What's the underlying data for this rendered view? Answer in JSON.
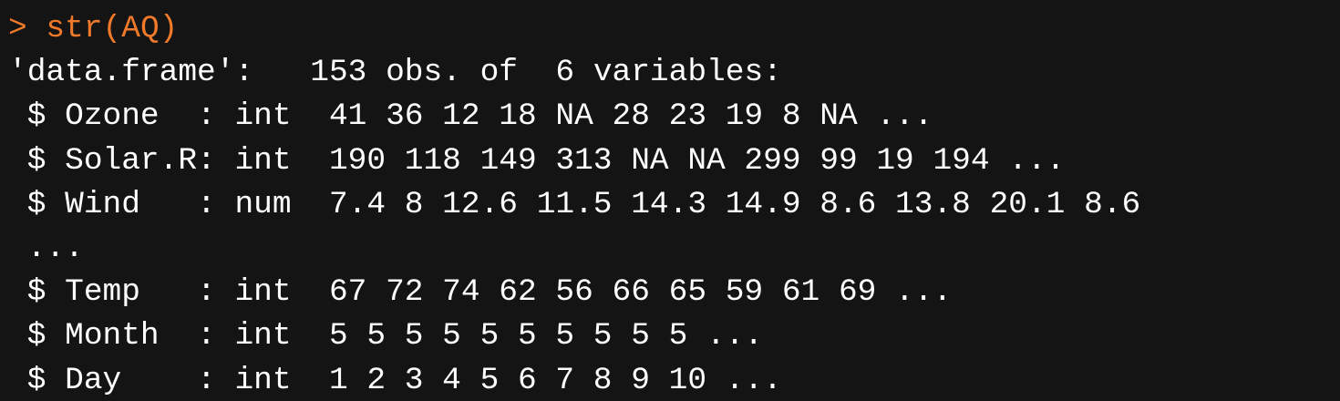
{
  "console": {
    "prompt": "> ",
    "command": "str(AQ)",
    "output": [
      "'data.frame':\t153 obs. of  6 variables:",
      " $ Ozone  : int  41 36 12 18 NA 28 23 19 8 NA ...",
      " $ Solar.R: int  190 118 149 313 NA NA 299 99 19 194 ...",
      " $ Wind   : num  7.4 8 12.6 11.5 14.3 14.9 8.6 13.8 20.1 8.6",
      " ...",
      " $ Temp   : int  67 72 74 62 56 66 65 59 61 69 ...",
      " $ Month  : int  5 5 5 5 5 5 5 5 5 5 ...",
      " $ Day    : int  1 2 3 4 5 6 7 8 9 10 ..."
    ]
  },
  "colors": {
    "background": "#141414",
    "command": "#f07a2a",
    "output": "#ffffff"
  }
}
